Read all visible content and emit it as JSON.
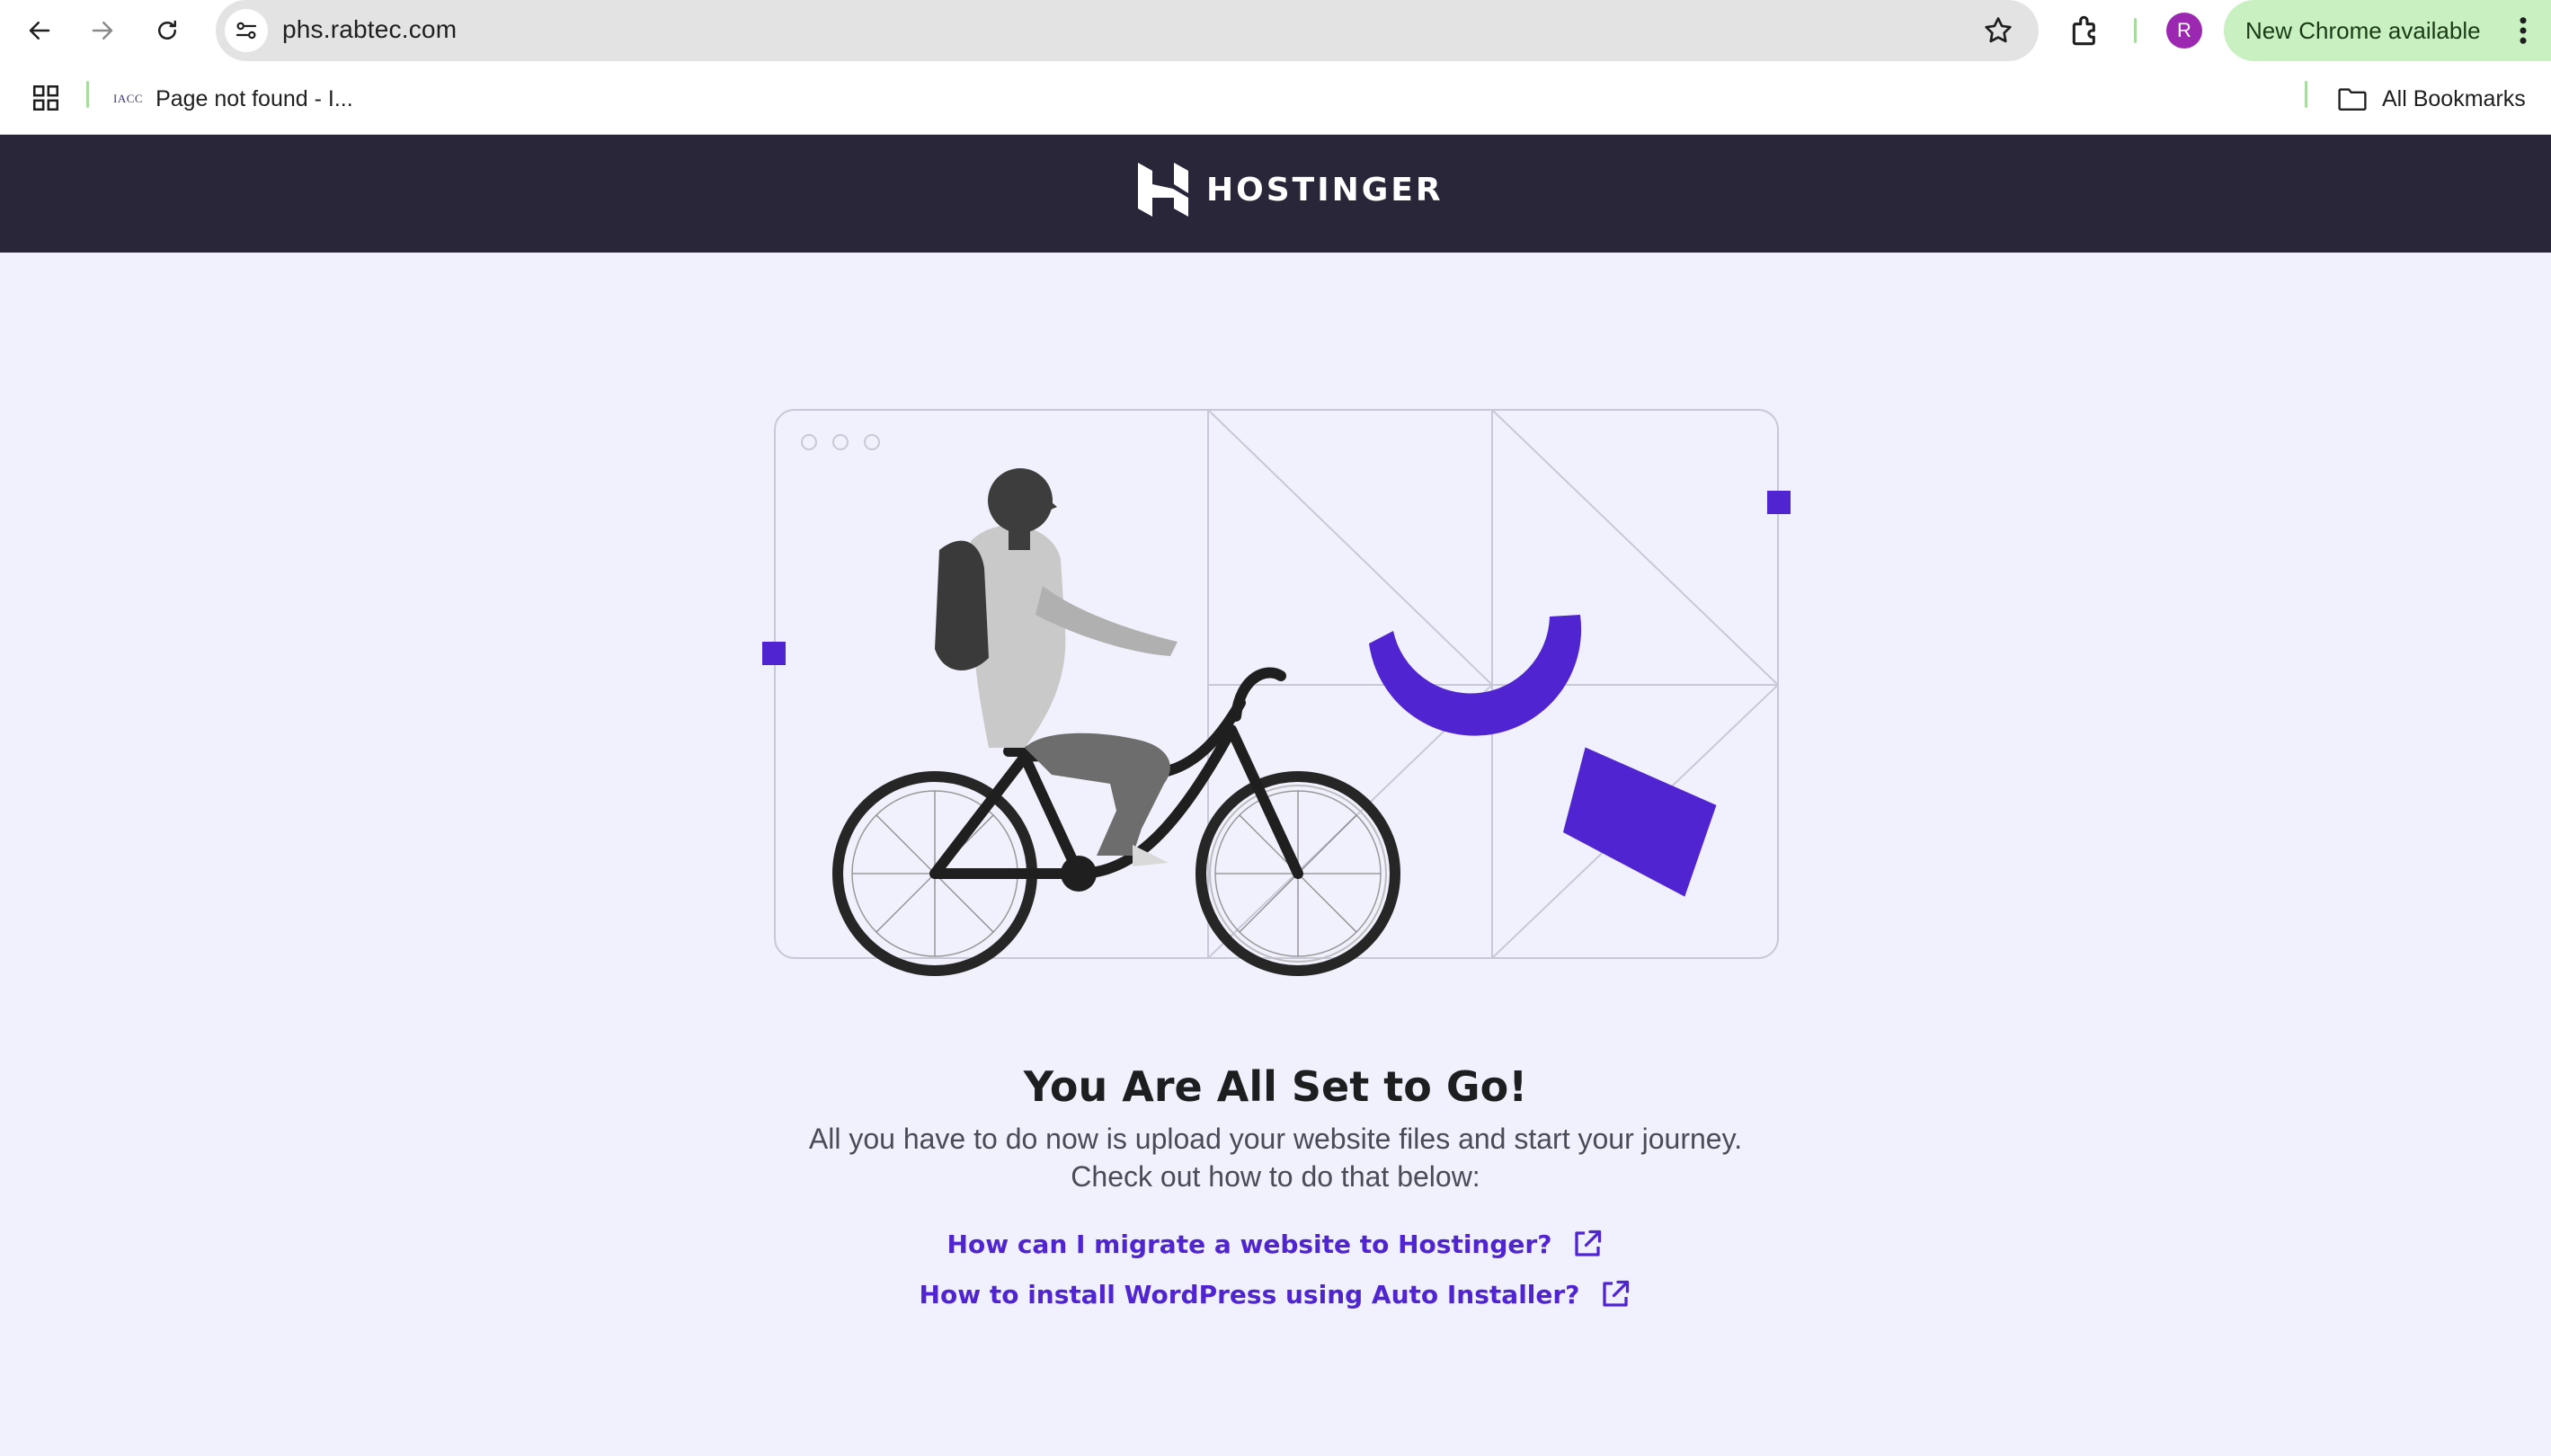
{
  "browser": {
    "url": "phs.rabtec.com",
    "update_label": "New Chrome available",
    "profile_initial": "R",
    "bookmarks": [
      {
        "favicon": "IACC",
        "label": "Page not found - I..."
      }
    ],
    "all_bookmarks_label": "All Bookmarks",
    "icons": [
      "back-arrow-icon",
      "forward-arrow-icon",
      "reload-icon",
      "site-info-icon",
      "star-icon",
      "extensions-icon",
      "kebab-menu-icon",
      "apps-grid-icon",
      "folder-icon"
    ]
  },
  "page": {
    "brand": "HOSTINGER",
    "headline": "You Are All Set to Go!",
    "subtext_line1": "All you have to do now is upload your website files and start your journey.",
    "subtext_line2": "Check out how to do that below:",
    "links": [
      {
        "label": "How can I migrate a website to Hostinger?",
        "icon": "external-link-icon"
      },
      {
        "label": "How to install WordPress using Auto Installer?",
        "icon": "external-link-icon"
      }
    ],
    "colors": {
      "header_bg": "#2a2639",
      "page_bg": "#f0f1fc",
      "accent": "#5025d1",
      "text_dark": "#1d1e20",
      "chrome_update": "#c8f0c0"
    }
  }
}
